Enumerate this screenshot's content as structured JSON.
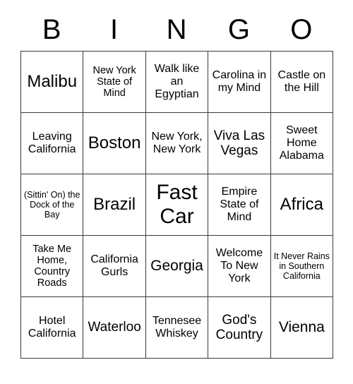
{
  "header": {
    "letters": [
      "B",
      "I",
      "N",
      "G",
      "O"
    ]
  },
  "grid": {
    "rows": [
      [
        {
          "text": "Malibu",
          "size": "fs-xxl"
        },
        {
          "text": "New York State of Mind",
          "size": "fs-sm"
        },
        {
          "text": "Walk like an Egyptian",
          "size": "fs-md"
        },
        {
          "text": "Carolina in my Mind",
          "size": "fs-md"
        },
        {
          "text": "Castle on the Hill",
          "size": "fs-md"
        }
      ],
      [
        {
          "text": "Leaving California",
          "size": "fs-md"
        },
        {
          "text": "Boston",
          "size": "fs-xxl"
        },
        {
          "text": "New York, New York",
          "size": "fs-md"
        },
        {
          "text": "Viva Las Vegas",
          "size": "fs-lg"
        },
        {
          "text": "Sweet Home Alabama",
          "size": "fs-md"
        }
      ],
      [
        {
          "text": "(Sittin' On) the Dock of the Bay",
          "size": "fs-xs"
        },
        {
          "text": "Brazil",
          "size": "fs-xxl"
        },
        {
          "text": "Fast Car",
          "size": "fs-huge"
        },
        {
          "text": "Empire State of Mind",
          "size": "fs-md"
        },
        {
          "text": "Africa",
          "size": "fs-xxl"
        }
      ],
      [
        {
          "text": "Take Me Home, Country Roads",
          "size": "fs-sm"
        },
        {
          "text": "California Gurls",
          "size": "fs-md"
        },
        {
          "text": "Georgia",
          "size": "fs-xl"
        },
        {
          "text": "Welcome To New York",
          "size": "fs-md"
        },
        {
          "text": "It Never Rains in Southern California",
          "size": "fs-xs"
        }
      ],
      [
        {
          "text": "Hotel California",
          "size": "fs-md"
        },
        {
          "text": "Waterloo",
          "size": "fs-lg"
        },
        {
          "text": "Tennesee Whiskey",
          "size": "fs-md"
        },
        {
          "text": "God's Country",
          "size": "fs-lg"
        },
        {
          "text": "Vienna",
          "size": "fs-xl"
        }
      ]
    ]
  }
}
